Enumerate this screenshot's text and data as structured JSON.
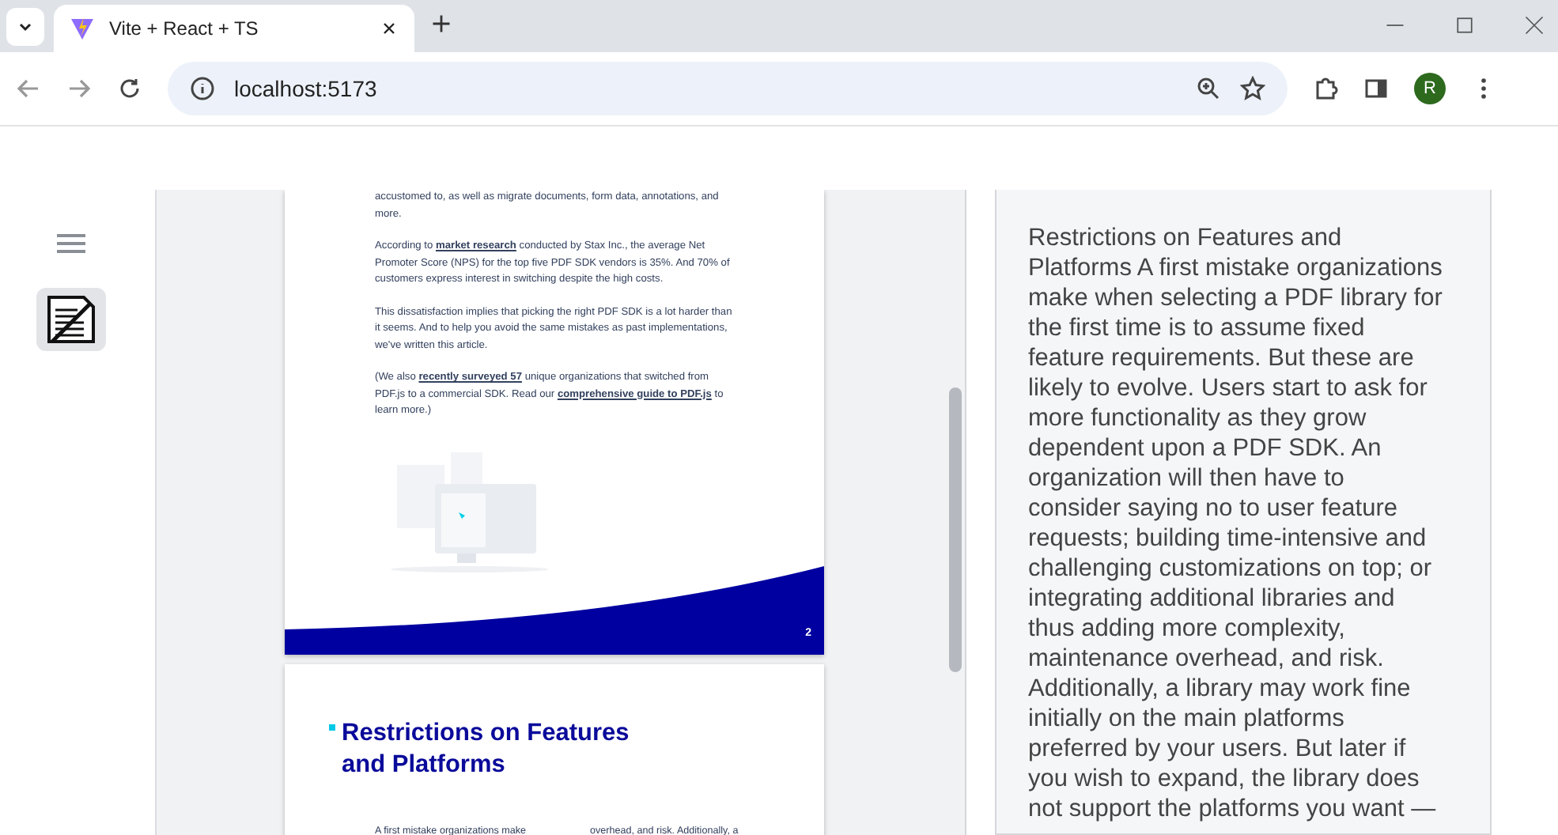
{
  "browser": {
    "tab": {
      "title": "Vite + React + TS",
      "selected": true
    },
    "address": "localhost:5173",
    "profile_initial": "R"
  },
  "document": {
    "pages": [
      {
        "kind": "text",
        "paragraphs": [
          [
            {
              "text": "accustomed to, as well as migrate documents, form data, annotations, and more.",
              "link": false
            }
          ],
          [
            {
              "text": "According to ",
              "link": false
            },
            {
              "text": "market research",
              "link": true
            },
            {
              "text": " conducted by Stax Inc., the average Net Promoter Score (NPS) for the top five PDF SDK vendors is 35%. And 70% of customers express interest in switching despite the high costs.",
              "link": false
            }
          ],
          [
            {
              "text": "This dissatisfaction implies that picking the right PDF SDK is a lot harder than it seems. And to help you avoid the same mistakes as past implementations, we've written this article.",
              "link": false
            }
          ],
          [
            {
              "text": "(We also ",
              "link": false
            },
            {
              "text": "recently surveyed 57",
              "link": true
            },
            {
              "text": " unique organizations that switched from PDF.js to a commercial SDK. Read our ",
              "link": false
            },
            {
              "text": "comprehensive guide to PDF.js",
              "link": true
            },
            {
              "text": " to learn more.)",
              "link": false
            }
          ]
        ],
        "page_number": "2"
      },
      {
        "kind": "heading",
        "heading": "Restrictions on Features and Platforms",
        "columns": [
          "A first mistake organizations make",
          "overhead, and risk. Additionally, a"
        ]
      }
    ]
  },
  "panel": {
    "text": "Restrictions on Features and Platforms A first mistake organizations make when selecting a PDF library for the first time is to assume fixed feature requirements. But these are likely to evolve. Users start to ask for more functionality as they grow dependent upon a PDF SDK. An organization will then have to consider saying no to user feature requests; building time-intensive and challenging customizations on top; or integrating additional libraries and thus adding more complexity, maintenance overhead, and risk. Additionally, a library may work fine initially on the main platforms preferred by your users. But later if you wish to expand, the library does not support the platforms you want —"
  }
}
